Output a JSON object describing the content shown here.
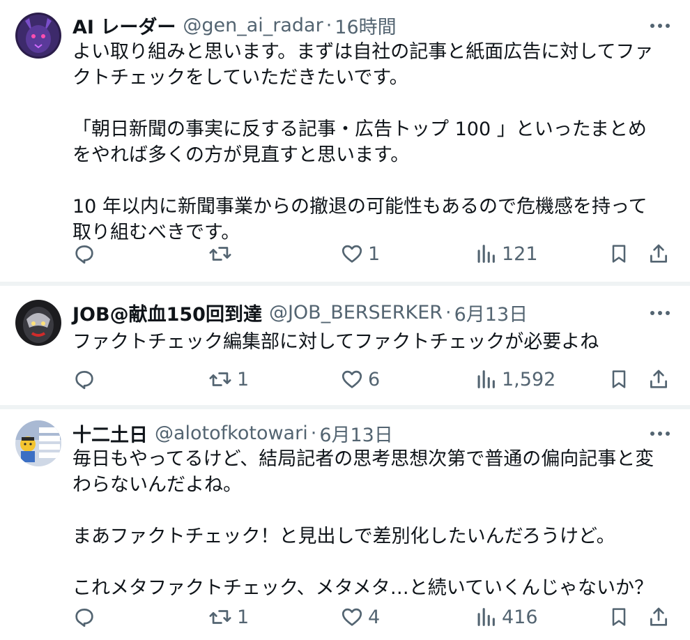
{
  "tweets": [
    {
      "name": "AI レーダー",
      "handle": "@gen_ai_radar",
      "dot": "·",
      "time": "16時間",
      "text": "よい取り組みと思います。まずは自社の記事と紙面広告に対してファ\nクトチェックをしていただきたいです。\n\n「朝日新聞の事実に反する記事・広告トップ 100 」といったまとめ\nをやれば多くの方が見直すと思います。\n\n10 年以内に新聞事業からの撤退の可能性もあるので危機感を持って\n取り組むべきです。",
      "retweets": "",
      "likes": "1",
      "views": "121"
    },
    {
      "name": "JOB@献血150回到達",
      "handle": "@JOB_BERSERKER",
      "dot": "·",
      "time": "6月13日",
      "text": "ファクトチェック編集部に対してファクトチェックが必要よね",
      "retweets": "1",
      "likes": "6",
      "views": "1,592"
    },
    {
      "name": "十二土日",
      "handle": "@alotofkotowari",
      "dot": "·",
      "time": "6月13日",
      "text": "毎日もやってるけど、結局記者の思考思想次第で普通の偏向記事と変\nわらないんだよね。\n\nまあファクトチェック！と見出しで差別化したいんだろうけど。\n\nこれメタファクトチェック、メタメタ…と続いていくんじゃないか？",
      "retweets": "1",
      "likes": "4",
      "views": "416"
    }
  ],
  "colors": {
    "text": "#0f1419",
    "secondary": "#536471",
    "separator": "#eff3f4"
  }
}
